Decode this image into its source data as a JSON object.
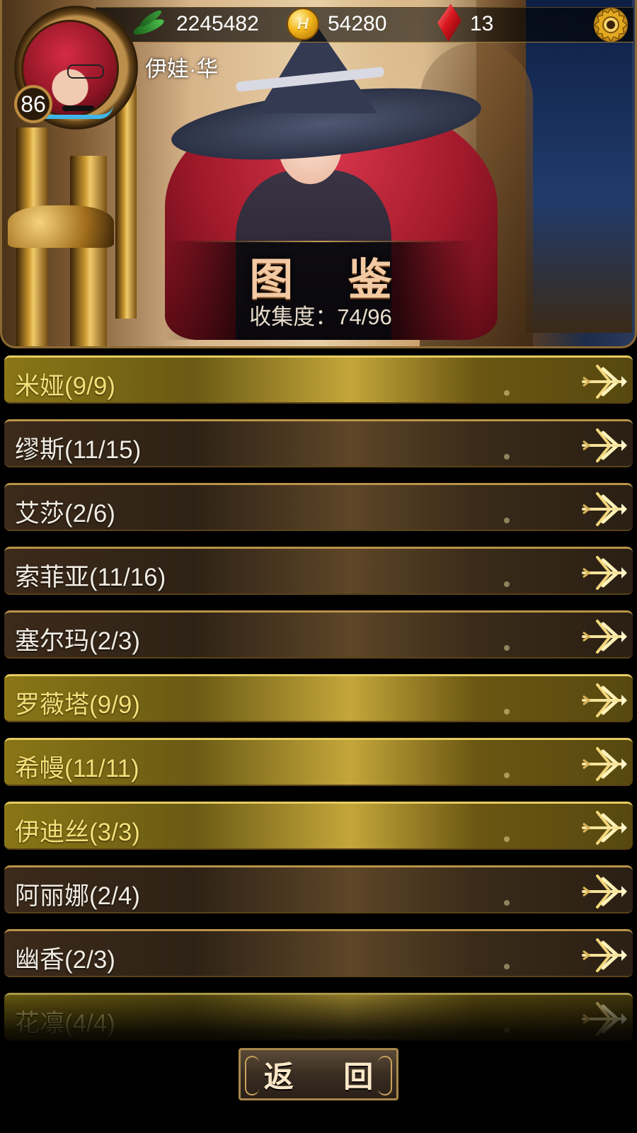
{
  "hud": {
    "stamina": "2245482",
    "gold": "54280",
    "gems": "13",
    "gold_icon_letter": "H"
  },
  "player": {
    "name": "伊娃·华",
    "level": "86"
  },
  "banner": {
    "title": "图 鉴",
    "collection": "收集度：74/96"
  },
  "list": [
    {
      "label": "米娅(9/9)",
      "complete": true
    },
    {
      "label": "缪斯(11/15)",
      "complete": false
    },
    {
      "label": "艾莎(2/6)",
      "complete": false
    },
    {
      "label": "索菲亚(11/16)",
      "complete": false
    },
    {
      "label": "塞尔玛(2/3)",
      "complete": false
    },
    {
      "label": "罗薇塔(9/9)",
      "complete": true
    },
    {
      "label": "希幔(11/11)",
      "complete": true
    },
    {
      "label": "伊迪丝(3/3)",
      "complete": true
    },
    {
      "label": "阿丽娜(2/4)",
      "complete": false
    },
    {
      "label": "幽香(2/3)",
      "complete": false
    },
    {
      "label": "花凛(4/4)",
      "complete": true
    }
  ],
  "back_button": "返 回",
  "colors": {
    "complete_text": "#f4e07a",
    "incomplete_text": "#f1ece2",
    "title": "#f2c9a2",
    "accent_gold": "#b99348"
  },
  "icons": {
    "stamina": "green-leaf-icon",
    "gold": "gold-coin-icon",
    "gems": "red-gem-icon",
    "settings": "gear-icon",
    "row_arrow": "golden-arrow-icon"
  }
}
